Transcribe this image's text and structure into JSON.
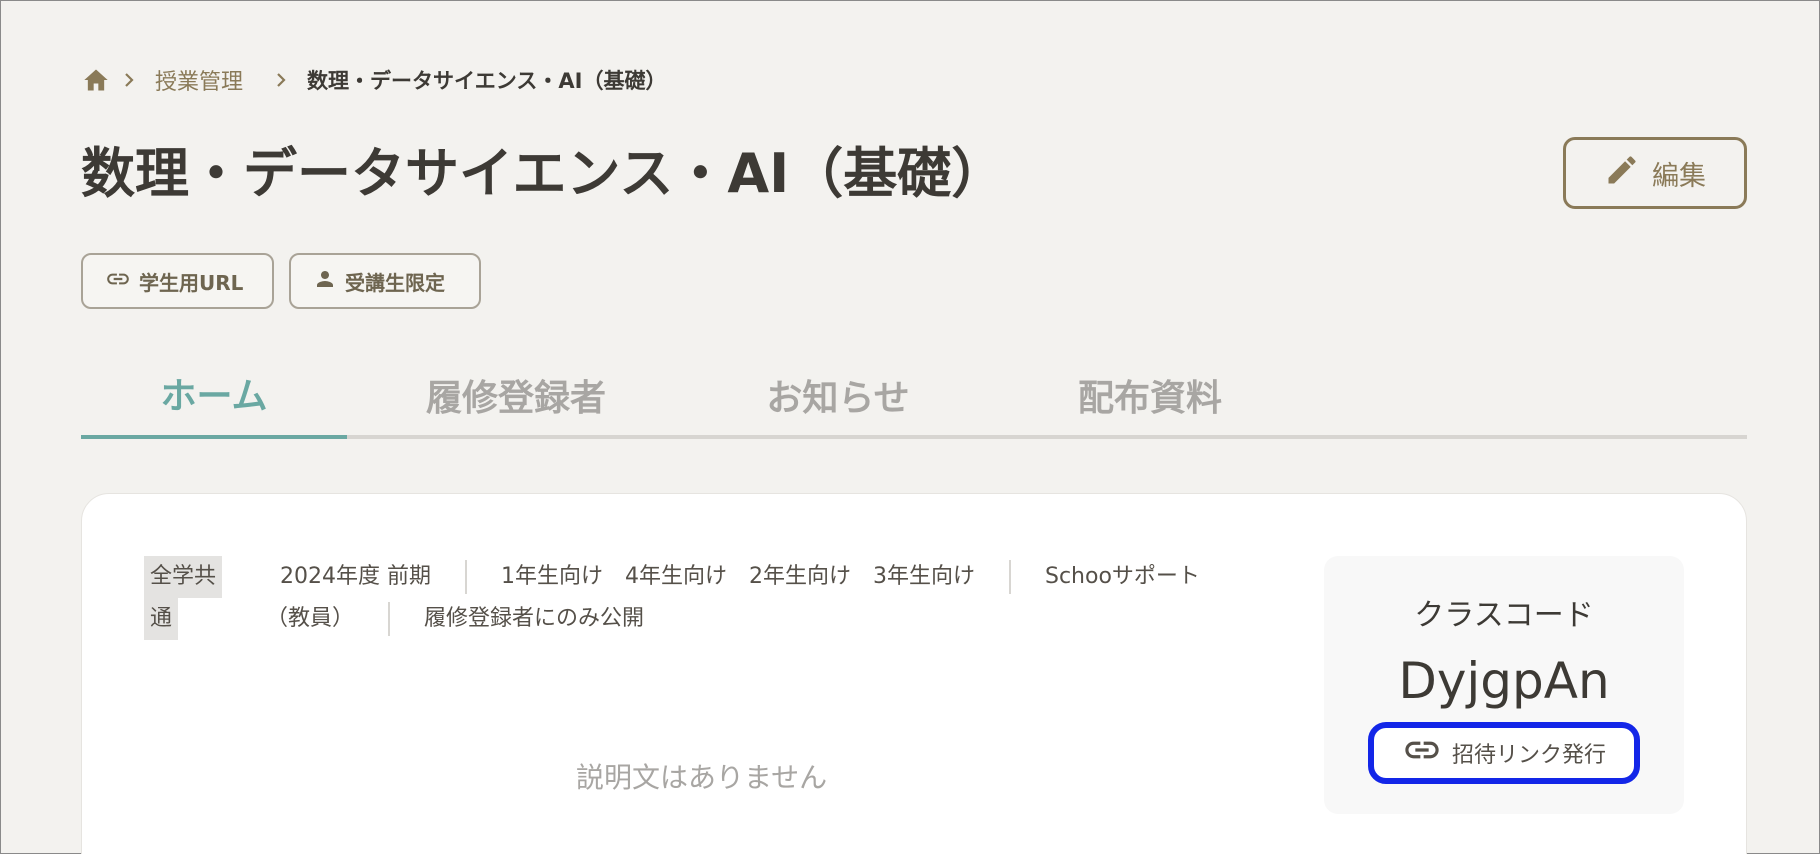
{
  "breadcrumb": {
    "home_icon": "home-icon",
    "items": [
      "授業管理",
      "数理・データサイエンス・AI（基礎）"
    ]
  },
  "page": {
    "title": "数理・データサイエンス・AI（基礎）",
    "edit_label": "編集"
  },
  "chips": {
    "student_url": "学生用URL",
    "restricted": "受講生限定"
  },
  "tabs": [
    {
      "label": "ホーム",
      "active": true
    },
    {
      "label": "履修登録者",
      "active": false
    },
    {
      "label": "お知らせ",
      "active": false
    },
    {
      "label": "配布資料",
      "active": false
    }
  ],
  "course": {
    "category_line1": "全学共",
    "category_line2": "通",
    "term": "2024年度 前期",
    "grades": [
      "1年生向け",
      "4年生向け",
      "2年生向け",
      "3年生向け"
    ],
    "support_line1": "Schooサポート",
    "support_line2": "（教員）",
    "visibility": "履修登録者にのみ公開",
    "description": "説明文はありません"
  },
  "class_code": {
    "label": "クラスコード",
    "code": "DyjgpAn",
    "invite_label": "招待リンク発行"
  },
  "colors": {
    "accent_brown": "#8a7a58",
    "active_tab": "#6aa8a2",
    "highlight_border": "#1326e8",
    "background": "#f3f2ef"
  }
}
